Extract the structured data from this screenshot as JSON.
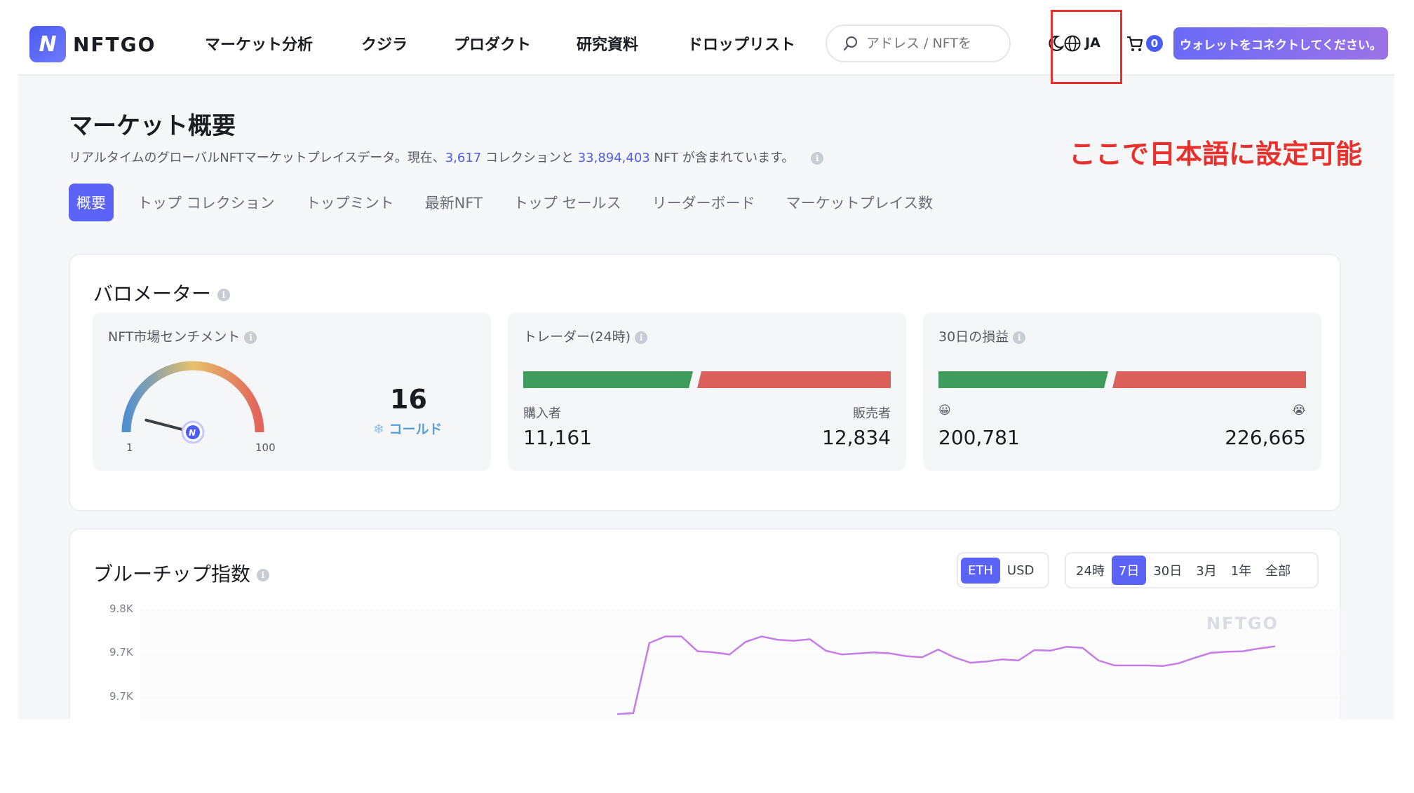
{
  "header": {
    "logo_text": "NFTGO",
    "nav": [
      "マーケット分析",
      "クジラ",
      "プロダクト",
      "研究資料",
      "ドロップリスト"
    ],
    "search_placeholder": "アドレス / NFTを",
    "language": "JA",
    "cart_count": "0",
    "connect_label": "ウォレットをコネクトしてください。"
  },
  "annotation": {
    "callout": "ここで日本語に設定可能"
  },
  "page": {
    "title": "マーケット概要",
    "subtitle_prefix": "リアルタイムのグローバルNFTマーケットプレイスデータ。現在、",
    "collections_count": "3,617",
    "subtitle_mid": " コレクションと ",
    "nft_count": "33,894,403",
    "subtitle_suffix": " NFT が含まれています。",
    "tabs": [
      "概要",
      "トップ コレクション",
      "トップミント",
      "最新NFT",
      "トップ セールス",
      "リーダーボード",
      "マーケットプレイス数"
    ],
    "active_tab": 0
  },
  "barometer": {
    "title": "バロメーター",
    "sentiment": {
      "title": "NFT市場センチメント",
      "value": "16",
      "label": "コールド",
      "min_label": "1",
      "max_label": "100",
      "gauge_fraction": 0.16
    },
    "traders": {
      "title": "トレーダー(24時)",
      "left_label": "購入者",
      "right_label": "販売者",
      "left_value": "11,161",
      "right_value": "12,834"
    },
    "pnl": {
      "title": "30日の損益",
      "left_emoji": "😀",
      "right_emoji": "😭",
      "left_value": "200,781",
      "right_value": "226,665"
    }
  },
  "bluechip": {
    "title": "ブルーチップ指数",
    "currency_options": [
      "ETH",
      "USD"
    ],
    "currency_selected": "ETH",
    "range_options": [
      "24時",
      "7日",
      "30日",
      "3月",
      "1年",
      "全部"
    ],
    "range_selected": "7日",
    "watermark": "NFTGO"
  },
  "chart_data": {
    "type": "line",
    "title": "",
    "xlabel": "",
    "ylabel": "",
    "y_tick_labels": [
      "9.8K",
      "9.7K",
      "9.7K"
    ],
    "ylim": [
      9640,
      9800
    ],
    "series": [
      {
        "values": [
          9610,
          9612,
          9740,
          9752,
          9752,
          9725,
          9723,
          9719,
          9742,
          9752,
          9746,
          9744,
          9747,
          9726,
          9719,
          9721,
          9723,
          9721,
          9716,
          9714,
          9728,
          9714,
          9704,
          9706,
          9710,
          9708,
          9727,
          9726,
          9733,
          9731,
          9708,
          9699,
          9699,
          9699,
          9698,
          9703,
          9713,
          9722,
          9724,
          9725,
          9730,
          9734
        ]
      }
    ],
    "line_color": "#c67be6"
  },
  "colors": {
    "accent": "#5a63f5",
    "buy": "#3f9b5c",
    "sell": "#db5f5a",
    "annotation": "#e8302c"
  }
}
